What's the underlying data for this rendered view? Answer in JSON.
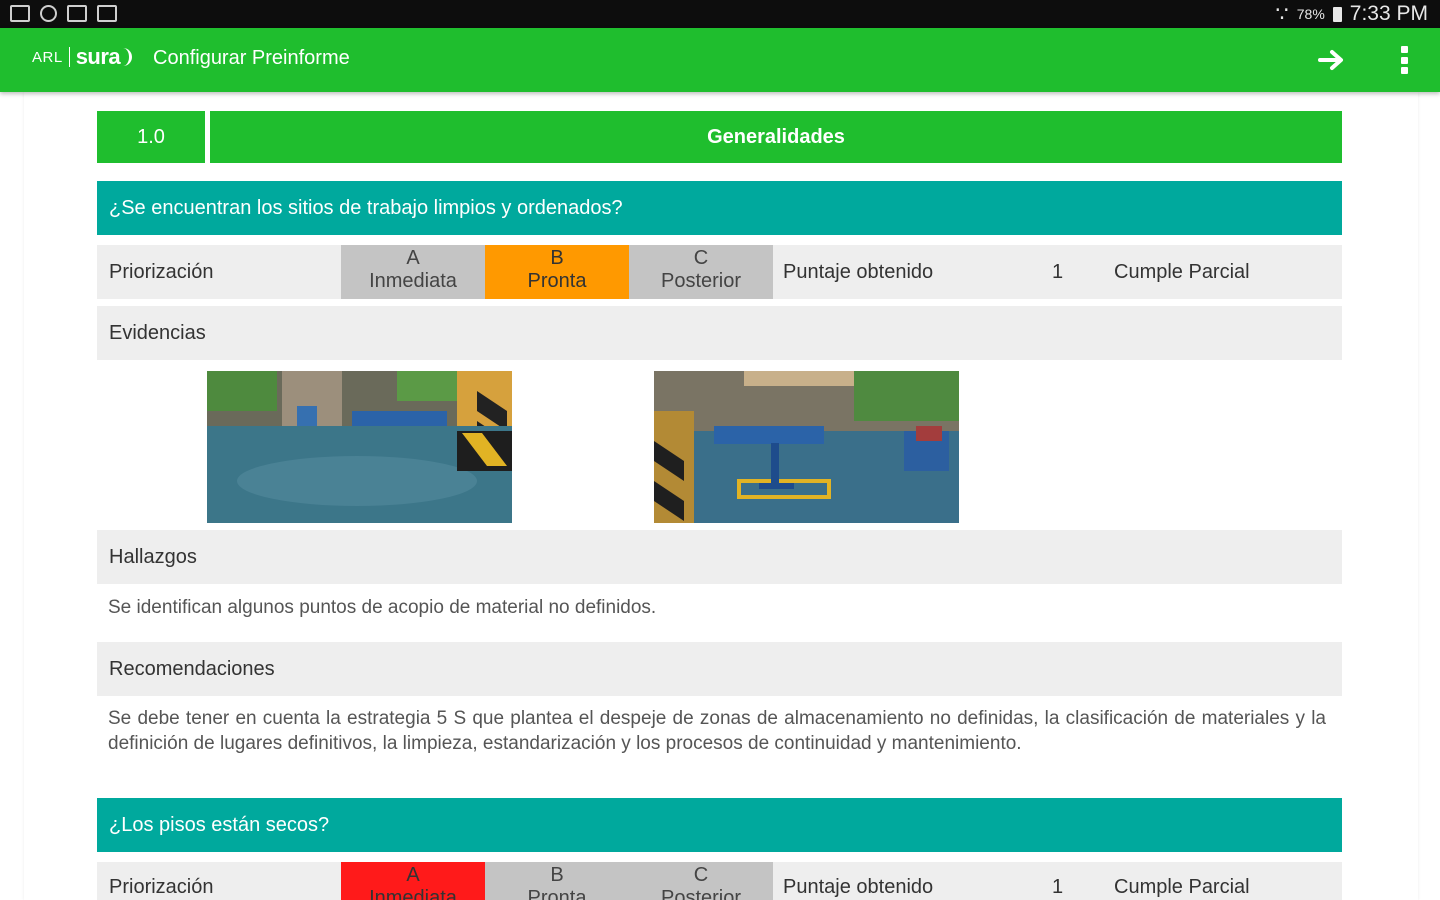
{
  "status_bar": {
    "battery": "78%",
    "time": "7:33 PM"
  },
  "app_bar": {
    "logo_arl": "ARL",
    "logo_brand": "sura",
    "title": "Configurar Preinforme"
  },
  "section": {
    "number": "1.0",
    "title": "Generalidades"
  },
  "labels": {
    "priorizacion": "Priorización",
    "puntaje": "Puntaje obtenido",
    "evidencias": "Evidencias",
    "hallazgos": "Hallazgos",
    "recomendaciones": "Recomendaciones"
  },
  "priority_options": [
    {
      "letter": "A",
      "name": "Inmediata"
    },
    {
      "letter": "B",
      "name": "Pronta"
    },
    {
      "letter": "C",
      "name": "Posterior"
    }
  ],
  "questions": [
    {
      "question": "¿Se encuentran los sitios de trabajo limpios y ordenados?",
      "selected_priority": "B",
      "score": "1",
      "score_text": "Cumple Parcial",
      "evidences": [
        "workshop-photo-1",
        "workshop-photo-2"
      ],
      "hallazgos": "Se identifican algunos puntos de acopio de material no definidos.",
      "recomendaciones": "Se debe tener en cuenta la estrategia 5 S que plantea el despeje de zonas de almacenamiento no definidas, la clasificación de materiales y la definición de lugares definitivos, la limpieza, estandarización y los procesos de continuidad y mantenimiento."
    },
    {
      "question": "¿Los pisos están secos?",
      "selected_priority": "A",
      "score": "1",
      "score_text": "Cumple Parcial"
    }
  ],
  "colors": {
    "brand_green": "#1fbe2e",
    "question_teal": "#00a99d",
    "priority_selected_b": "#ff9900",
    "priority_selected_a": "#ff1a1a",
    "priority_default": "#c4c4c4"
  }
}
